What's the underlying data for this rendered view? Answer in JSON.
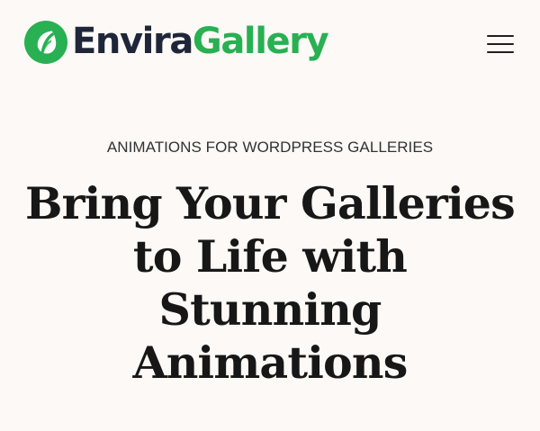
{
  "header": {
    "brand": {
      "word1": "Envira",
      "word2": "Gallery",
      "logo_icon": "leaf-logo-icon",
      "colors": {
        "navy": "#20263a",
        "green": "#28b052"
      }
    },
    "menu_icon": "hamburger-menu-icon"
  },
  "hero": {
    "eyebrow": "ANIMATIONS FOR WORDPRESS GALLERIES",
    "title_lines": [
      "Bring Your Galleries",
      "to Life with",
      "Stunning",
      "Animations"
    ]
  },
  "colors": {
    "background": "#fcf9f6",
    "heading": "#171717",
    "eyebrow": "#323232"
  }
}
